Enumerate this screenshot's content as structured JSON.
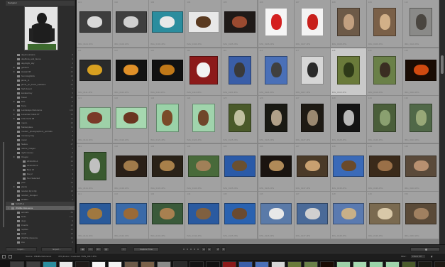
{
  "navigator": {
    "title": "Navigator"
  },
  "folders": [
    {
      "name": "day/mountains",
      "count": "8",
      "ind": 2
    },
    {
      "name": "day/flora_and_fauna",
      "count": "3",
      "ind": 2
    },
    {
      "name": "day/night_sky",
      "count": "4",
      "ind": 2
    },
    {
      "name": "gardens",
      "count": "12",
      "ind": 2,
      "tri": true
    },
    {
      "name": "Hawaii 08",
      "count": "41",
      "ind": 2,
      "tri": true
    },
    {
      "name": "hummingbirds",
      "count": "16",
      "ind": 2
    },
    {
      "name": "jamie_ct",
      "count": "9",
      "ind": 2
    },
    {
      "name": "jamie_pc_travel_websites",
      "count": "22",
      "ind": 2
    },
    {
      "name": "high desert",
      "count": "7",
      "ind": 2
    },
    {
      "name": "kanaka bay",
      "count": "5",
      "ind": 2
    },
    {
      "name": "Kauai",
      "count": "18",
      "ind": 2
    },
    {
      "name": "kids",
      "count": "6",
      "ind": 2,
      "tri": true
    },
    {
      "name": "Kona",
      "count": "14",
      "ind": 2
    },
    {
      "name": "Landscape Reference",
      "count": "103",
      "ind": 2,
      "tri": true
    },
    {
      "name": "Lavender Fields 07",
      "count": "31",
      "ind": 2,
      "tri": true
    },
    {
      "name": "Little Gulls 08",
      "count": "12",
      "ind": 2,
      "tri": true
    },
    {
      "name": "macro",
      "count": "20",
      "ind": 2
    },
    {
      "name": "Marketplace",
      "count": "11",
      "ind": 2
    },
    {
      "name": "modern_photographers_portraits",
      "count": "3",
      "ind": 2
    },
    {
      "name": "monterey bay",
      "count": "8",
      "ind": 2
    },
    {
      "name": "music",
      "count": "6",
      "ind": 2
    },
    {
      "name": "Nature",
      "count": "27",
      "ind": 2
    },
    {
      "name": "nature_images",
      "count": "5",
      "ind": 2
    },
    {
      "name": "night scenes",
      "count": "9",
      "ind": 2
    },
    {
      "name": "Oregon",
      "count": "47",
      "ind": 2,
      "tri": true
    },
    {
      "name": "2010-06-14",
      "count": "12",
      "ind": 3
    },
    {
      "name": "2010-06-15",
      "count": "10",
      "ind": 3
    },
    {
      "name": "Best Of",
      "count": "7",
      "ind": 3
    },
    {
      "name": "Day 2",
      "count": "9",
      "ind": 3
    },
    {
      "name": "Non Selected",
      "count": "9",
      "ind": 3
    },
    {
      "name": "pets",
      "count": "14",
      "ind": 2
    },
    {
      "name": "plants",
      "count": "6",
      "ind": 2,
      "tri": true
    },
    {
      "name": "random lily & lily",
      "count": "18",
      "ind": 2
    },
    {
      "name": "random_bouquet",
      "count": "4",
      "ind": 2
    },
    {
      "name": "ROBIN",
      "count": "2",
      "ind": 2
    },
    {
      "name": "SAMPLE",
      "count": "",
      "ind": 1,
      "root": true
    },
    {
      "name": "Wildlife Reference",
      "count": "476",
      "ind": 1,
      "selected": true,
      "tri": true
    },
    {
      "name": "animals",
      "count": "83",
      "ind": 2
    },
    {
      "name": "birds",
      "count": "172",
      "ind": 2
    },
    {
      "name": "dogs",
      "count": "9",
      "ind": 2
    },
    {
      "name": "insects",
      "count": "28",
      "ind": 2
    },
    {
      "name": "reptiles",
      "count": "31",
      "ind": 2
    },
    {
      "name": "seals",
      "count": "16",
      "ind": 2
    },
    {
      "name": "WHITE reference",
      "count": "12",
      "ind": 2
    },
    {
      "name": "zoo",
      "count": "8",
      "ind": 2
    },
    {
      "name": "forest",
      "count": "4",
      "ind": 2
    },
    {
      "name": "insect trees",
      "count": "12",
      "ind": 2
    },
    {
      "name": "parks",
      "count": "5",
      "ind": 2
    },
    {
      "name": "bugs and bees",
      "count": "9",
      "ind": 2
    },
    {
      "name": "zoo/animals",
      "count": "43",
      "ind": 2
    }
  ],
  "left_buttons": {
    "import": "Import...",
    "export": "Export..."
  },
  "grid": {
    "selected_index": 17,
    "cells": [
      {
        "num": "101",
        "meta": "IMG_0101.JPG",
        "bg": "#3d3d3d",
        "fg": "#d8d8d8",
        "w": 44,
        "h": 30
      },
      {
        "num": "102",
        "meta": "IMG_0102.JPG",
        "bg": "#3f3f3f",
        "fg": "#d0d0d0",
        "w": 44,
        "h": 30
      },
      {
        "num": "103",
        "meta": "IMG_0103.JPG",
        "bg": "#2b8d9e",
        "fg": "#e8e8e8",
        "w": 44,
        "h": 30
      },
      {
        "num": "104",
        "meta": "IMG_0104.JPG",
        "bg": "#e8e8e8",
        "fg": "#5a3a20",
        "w": 44,
        "h": 30
      },
      {
        "num": "105",
        "meta": "IMG_0105.JPG",
        "bg": "#1f1a18",
        "fg": "#9a4a30",
        "w": 44,
        "h": 30
      },
      {
        "num": "106",
        "meta": "IMG_0106.JPG",
        "bg": "#f5f5f5",
        "fg": "#d42020",
        "w": 32,
        "h": 40
      },
      {
        "num": "107",
        "meta": "IMG_0107.JPG",
        "bg": "#f3f3f3",
        "fg": "#c8201c",
        "w": 32,
        "h": 40
      },
      {
        "num": "108",
        "meta": "IMG_0108.JPG",
        "bg": "#6d5a48",
        "fg": "#c2a080",
        "w": 32,
        "h": 40
      },
      {
        "num": "109",
        "meta": "IMG_0109.JPG",
        "bg": "#7a6048",
        "fg": "#d2b088",
        "w": 32,
        "h": 40
      },
      {
        "num": "110",
        "meta": "IMG_0110.JPG",
        "bg": "#8a8a88",
        "fg": "#4a4640",
        "w": 32,
        "h": 40
      },
      {
        "num": "111",
        "meta": "IMG_0111.JPG",
        "bg": "#2a2a2a",
        "fg": "#d8a020",
        "w": 44,
        "h": 30
      },
      {
        "num": "112",
        "meta": "IMG_0112.JPG",
        "bg": "#141414",
        "fg": "#e09028",
        "w": 44,
        "h": 30
      },
      {
        "num": "113",
        "meta": "IMG_0113.JPG",
        "bg": "#111111",
        "fg": "#c07818",
        "w": 44,
        "h": 30
      },
      {
        "num": "114",
        "meta": "IMG_0114.JPG",
        "bg": "#8c1a1a",
        "fg": "#f2f2f2",
        "w": 40,
        "h": 40
      },
      {
        "num": "115",
        "meta": "IMG_0115.JPG",
        "bg": "#3a5ea8",
        "fg": "#3a3a3a",
        "w": 32,
        "h": 40
      },
      {
        "num": "116",
        "meta": "IMG_0116.JPG",
        "bg": "#4a70b8",
        "fg": "#404040",
        "w": 32,
        "h": 40
      },
      {
        "num": "117",
        "meta": "IMG_0117.JPG",
        "bg": "#d6d6d6",
        "fg": "#2a2a2a",
        "w": 32,
        "h": 40
      },
      {
        "num": "118",
        "meta": "IMG_0118.JPG",
        "bg": "#6a7a3a",
        "fg": "#2e3a18",
        "w": 32,
        "h": 40
      },
      {
        "num": "119",
        "meta": "IMG_0119.JPG",
        "bg": "#6a8048",
        "fg": "#3a2e22",
        "w": 32,
        "h": 40
      },
      {
        "num": "120",
        "meta": "IMG_0120.JPG",
        "bg": "#1a0c04",
        "fg": "#d04a10",
        "w": 44,
        "h": 30
      },
      {
        "num": "121",
        "meta": "IMG_0121.JPG",
        "bg": "#9ed0a8",
        "fg": "#7a3a28",
        "w": 44,
        "h": 30
      },
      {
        "num": "122",
        "meta": "IMG_0122.JPG",
        "bg": "#a6d8b0",
        "fg": "#6a3420",
        "w": 44,
        "h": 30
      },
      {
        "num": "123",
        "meta": "IMG_0123.JPG",
        "bg": "#9ad2a8",
        "fg": "#7a4a28",
        "w": 32,
        "h": 40
      },
      {
        "num": "124",
        "meta": "IMG_0124.JPG",
        "bg": "#a0d4ac",
        "fg": "#70462a",
        "w": 32,
        "h": 40
      },
      {
        "num": "125",
        "meta": "IMG_0125.JPG",
        "bg": "#4a5a2a",
        "fg": "#c0c0a0",
        "w": 32,
        "h": 40
      },
      {
        "num": "126",
        "meta": "IMG_0126.JPG",
        "bg": "#1a1a14",
        "fg": "#b0a088",
        "w": 32,
        "h": 40
      },
      {
        "num": "127",
        "meta": "IMG_0127.JPG",
        "bg": "#1e1a14",
        "fg": "#9a8870",
        "w": 32,
        "h": 40
      },
      {
        "num": "128",
        "meta": "IMG_0128.JPG",
        "bg": "#141414",
        "fg": "#b8b8b8",
        "w": 32,
        "h": 40
      },
      {
        "num": "129",
        "meta": "IMG_0129.JPG",
        "bg": "#4a5e3a",
        "fg": "#8aa070",
        "w": 32,
        "h": 40
      },
      {
        "num": "130",
        "meta": "IMG_0130.JPG",
        "bg": "#506848",
        "fg": "#98a878",
        "w": 32,
        "h": 40
      },
      {
        "num": "131",
        "meta": "IMG_0131.JPG",
        "bg": "#3a5a30",
        "fg": "#c0c0c0",
        "w": 32,
        "h": 40
      },
      {
        "num": "132",
        "meta": "IMG_0132.JPG",
        "bg": "#2a2018",
        "fg": "#a07a4a",
        "w": 44,
        "h": 30
      },
      {
        "num": "133",
        "meta": "IMG_0133.JPG",
        "bg": "#2a2218",
        "fg": "#a8804a",
        "w": 44,
        "h": 30
      },
      {
        "num": "134",
        "meta": "IMG_0134.JPG",
        "bg": "#486a3a",
        "fg": "#a08058",
        "w": 44,
        "h": 30
      },
      {
        "num": "135",
        "meta": "IMG_0135.JPG",
        "bg": "#2a5aa8",
        "fg": "#6a5030",
        "w": 44,
        "h": 30
      },
      {
        "num": "136",
        "meta": "IMG_0136.JPG",
        "bg": "#1a1410",
        "fg": "#b08a58",
        "w": 44,
        "h": 30
      },
      {
        "num": "137",
        "meta": "IMG_0137.JPG",
        "bg": "#4a3a28",
        "fg": "#c8a070",
        "w": 44,
        "h": 30
      },
      {
        "num": "138",
        "meta": "IMG_0138.JPG",
        "bg": "#3a6ab8",
        "fg": "#6a4a2a",
        "w": 44,
        "h": 30
      },
      {
        "num": "139",
        "meta": "IMG_0139.JPG",
        "bg": "#3a2a1a",
        "fg": "#9a7048",
        "w": 44,
        "h": 30
      },
      {
        "num": "140",
        "meta": "IMG_0140.JPG",
        "bg": "#5a4a3a",
        "fg": "#b89070",
        "w": 44,
        "h": 30
      },
      {
        "num": "141",
        "meta": "IMG_0141.JPG",
        "bg": "#2a5a9a",
        "fg": "#a07840",
        "w": 44,
        "h": 30
      },
      {
        "num": "142",
        "meta": "IMG_0142.JPG",
        "bg": "#3a6aa8",
        "fg": "#9a6a38",
        "w": 44,
        "h": 30
      },
      {
        "num": "143",
        "meta": "IMG_0143.JPG",
        "bg": "#3a5a3a",
        "fg": "#a88050",
        "w": 44,
        "h": 30
      },
      {
        "num": "144",
        "meta": "IMG_0144.JPG",
        "bg": "#2a5aa0",
        "fg": "#806040",
        "w": 44,
        "h": 30
      },
      {
        "num": "145",
        "meta": "IMG_0145.JPG",
        "bg": "#2a62b0",
        "fg": "#6a4a30",
        "w": 44,
        "h": 30
      },
      {
        "num": "146",
        "meta": "IMG_0146.JPG",
        "bg": "#5a7aa8",
        "fg": "#e8e8e8",
        "w": 44,
        "h": 30
      },
      {
        "num": "147",
        "meta": "IMG_0147.JPG",
        "bg": "#4a6a98",
        "fg": "#d0d0d0",
        "w": 44,
        "h": 30
      },
      {
        "num": "148",
        "meta": "IMG_0148.JPG",
        "bg": "#5a7ab0",
        "fg": "#c8b088",
        "w": 44,
        "h": 30
      },
      {
        "num": "149",
        "meta": "IMG_0149.JPG",
        "bg": "#7a6a50",
        "fg": "#d8c8a8",
        "w": 44,
        "h": 30
      },
      {
        "num": "150",
        "meta": "IMG_0150.JPG",
        "bg": "#5a4a38",
        "fg": "#a08060",
        "w": 44,
        "h": 30
      }
    ]
  },
  "toolbar": {
    "sort_label": "Capture Time"
  },
  "filmstrip": {
    "source": "Source : Wildlife Reference",
    "status": "476 photos / 1 selected / IMG_0117.JPG",
    "filter_label": "Filter :",
    "filter_value": "Filters Off"
  }
}
